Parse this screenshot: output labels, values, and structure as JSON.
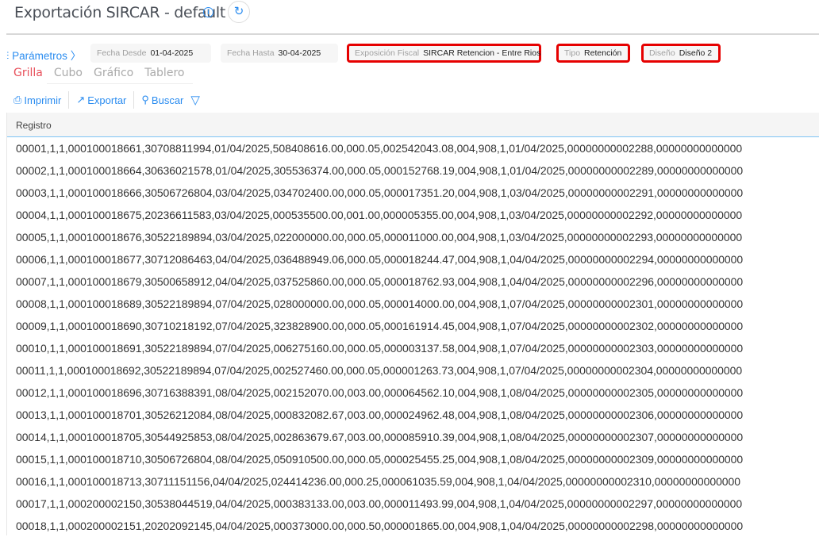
{
  "header": {
    "title": "Exportación SIRCAR - default",
    "info_icon": "i",
    "refresh_icon": "↻"
  },
  "params": {
    "label": "Parámetros",
    "fecha_desde": {
      "label": "Fecha Desde",
      "value": "01-04-2025"
    },
    "fecha_hasta": {
      "label": "Fecha Hasta",
      "value": "30-04-2025"
    },
    "exposicion": {
      "label": "Exposición Fiscal",
      "value": "SIRCAR Retencion - Entre Rios"
    },
    "tipo": {
      "label": "Tipo",
      "value": "Retención"
    },
    "diseno": {
      "label": "Diseño",
      "value": "Diseño 2"
    }
  },
  "tabs": [
    "Grilla",
    "Cubo",
    "Gráfico",
    "Tablero"
  ],
  "toolbar": {
    "print": "Imprimir",
    "export": "Exportar",
    "search": "Buscar"
  },
  "grid": {
    "column": "Registro",
    "rows": [
      "00001,1,1,000100018661,30708811994,01/04/2025,508408616.00,000.05,002542043.08,004,908,1,01/04/2025,00000000002288,00000000000000",
      "00002,1,1,000100018664,30636021578,01/04/2025,305536374.00,000.05,000152768.19,004,908,1,01/04/2025,00000000002289,00000000000000",
      "00003,1,1,000100018666,30506726804,03/04/2025,034702400.00,000.05,000017351.20,004,908,1,03/04/2025,00000000002291,00000000000000",
      "00004,1,1,000100018675,20236611583,03/04/2025,000535500.00,001.00,000005355.00,004,908,1,03/04/2025,00000000002292,00000000000000",
      "00005,1,1,000100018676,30522189894,03/04/2025,022000000.00,000.05,000011000.00,004,908,1,03/04/2025,00000000002293,00000000000000",
      "00006,1,1,000100018677,30712086463,04/04/2025,036488949.06,000.05,000018244.47,004,908,1,04/04/2025,00000000002294,00000000000000",
      "00007,1,1,000100018679,30500658912,04/04/2025,037525860.00,000.05,000018762.93,004,908,1,04/04/2025,00000000002296,00000000000000",
      "00008,1,1,000100018689,30522189894,07/04/2025,028000000.00,000.05,000014000.00,004,908,1,07/04/2025,00000000002301,00000000000000",
      "00009,1,1,000100018690,30710218192,07/04/2025,323828900.00,000.05,000161914.45,004,908,1,07/04/2025,00000000002302,00000000000000",
      "00010,1,1,000100018691,30522189894,07/04/2025,006275160.00,000.05,000003137.58,004,908,1,07/04/2025,00000000002303,00000000000000",
      "00011,1,1,000100018692,30522189894,07/04/2025,002527460.00,000.05,000001263.73,004,908,1,07/04/2025,00000000002304,00000000000000",
      "00012,1,1,000100018696,30716388391,08/04/2025,002152070.00,003.00,000064562.10,004,908,1,08/04/2025,00000000002305,00000000000000",
      "00013,1,1,000100018701,30526212084,08/04/2025,000832082.67,003.00,000024962.48,004,908,1,08/04/2025,00000000002306,00000000000000",
      "00014,1,1,000100018705,30544925853,08/04/2025,002863679.67,003.00,000085910.39,004,908,1,08/04/2025,00000000002307,00000000000000",
      "00015,1,1,000100018710,30506726804,08/04/2025,050910500.00,000.05,000025455.25,004,908,1,08/04/2025,00000000002309,00000000000000",
      "00016,1,1,000100018713,30711151156,04/04/2025,024414236.00,000.25,000061035.59,004,908,1,04/04/2025,00000000002310,00000000000000",
      "00017,1,1,000200002150,30538044519,04/04/2025,000383133.00,003.00,000011493.99,004,908,1,04/04/2025,00000000002297,00000000000000",
      "00018,1,1,000200002151,20202092145,04/04/2025,000373000.00,000.50,000001865.00,004,908,1,04/04/2025,00000000002298,00000000000000"
    ]
  }
}
